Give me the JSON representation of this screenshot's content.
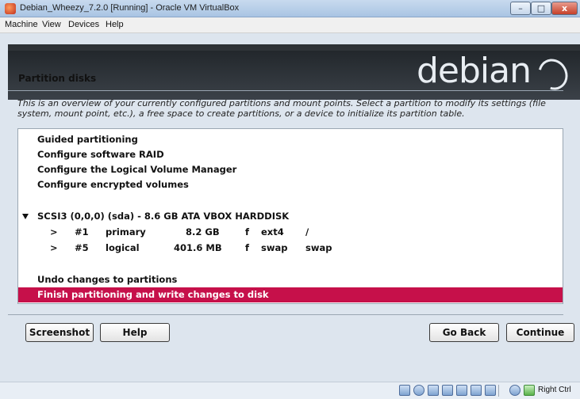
{
  "window": {
    "title": "Debian_Wheezy_7.2.0 [Running] - Oracle VM VirtualBox",
    "min_label": "–",
    "max_label": "□",
    "close_label": "x"
  },
  "menubar": {
    "items": [
      "Machine",
      "View",
      "Devices",
      "Help"
    ]
  },
  "installer": {
    "logo_text": "debian",
    "step_title": "Partition disks",
    "description": "This is an overview of your currently configured partitions and mount points. Select a partition to modify its settings (file system, mount point, etc.), a free space to create partitions, or a device to initialize its partition table.",
    "options": {
      "guided": "Guided partitioning",
      "raid": "Configure software RAID",
      "lvm": "Configure the Logical Volume Manager",
      "encrypted": "Configure encrypted volumes",
      "disk": "SCSI3 (0,0,0) (sda) - 8.6 GB ATA VBOX HARDDISK",
      "undo": "Undo changes to partitions",
      "finish": "Finish partitioning and write changes to disk"
    },
    "partitions": [
      {
        "marker": ">",
        "num": "#1",
        "type": "primary",
        "size": "8.2 GB",
        "flag": "f",
        "fs": "ext4",
        "mount": "/"
      },
      {
        "marker": ">",
        "num": "#5",
        "type": "logical",
        "size": "401.6 MB",
        "flag": "f",
        "fs": "swap",
        "mount": "swap"
      }
    ],
    "buttons": {
      "screenshot": "Screenshot",
      "help": "Help",
      "back": "Go Back",
      "continue": "Continue"
    },
    "selection_color": "#c6104a"
  },
  "statusbar": {
    "host_key": "Right Ctrl",
    "icons": [
      "hard-disk-icon",
      "optical-drive-icon",
      "usb-icon",
      "shared-folders-icon",
      "network-icon",
      "display-icon",
      "capture-mouse-icon",
      "mouse-integration-icon"
    ]
  }
}
